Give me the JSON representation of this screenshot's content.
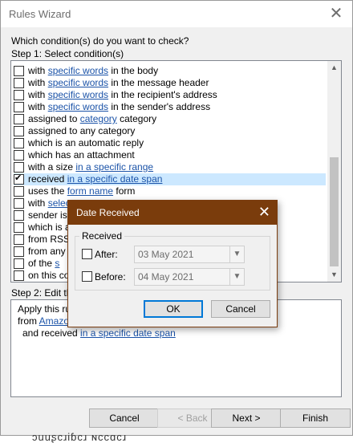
{
  "window": {
    "title": "Rules Wizard",
    "close_glyph": "✕"
  },
  "question": "Which condition(s) do you want to check?",
  "step1": "Step 1: Select condition(s)",
  "conditions": [
    {
      "pre": "with ",
      "link": "specific words",
      "post": " in the body",
      "checked": false
    },
    {
      "pre": "with ",
      "link": "specific words",
      "post": " in the message header",
      "checked": false
    },
    {
      "pre": "with ",
      "link": "specific words",
      "post": " in the recipient's address",
      "checked": false
    },
    {
      "pre": "with ",
      "link": "specific words",
      "post": " in the sender's address",
      "checked": false
    },
    {
      "pre": "assigned to ",
      "link": "category",
      "post": " category",
      "checked": false
    },
    {
      "pre": "assigned to any category",
      "link": "",
      "post": "",
      "checked": false
    },
    {
      "pre": "which is an automatic reply",
      "link": "",
      "post": "",
      "checked": false
    },
    {
      "pre": "which has an attachment",
      "link": "",
      "post": "",
      "checked": false
    },
    {
      "pre": "with a size ",
      "link": "in a specific range",
      "post": "",
      "checked": false
    },
    {
      "pre": "received ",
      "link": "in a specific date span",
      "post": "",
      "checked": true
    },
    {
      "pre": "uses the ",
      "link": "form name",
      "post": " form",
      "checked": false
    },
    {
      "pre": "with ",
      "link": "selec",
      "post": "",
      "checked": false
    },
    {
      "pre": "sender is i",
      "link": "",
      "post": "",
      "checked": false
    },
    {
      "pre": "which is a",
      "link": "",
      "post": "",
      "checked": false
    },
    {
      "pre": "from RSS F",
      "link": "",
      "post": "",
      "checked": false
    },
    {
      "pre": "from any R",
      "link": "",
      "post": "",
      "checked": false
    },
    {
      "pre": "of the ",
      "link": "s",
      "post": "",
      "checked": false
    },
    {
      "pre": "on this co",
      "link": "",
      "post": "",
      "checked": false
    }
  ],
  "step2": "Step 2: Edit th",
  "description": {
    "line1": "Apply this ru",
    "line2_pre": "from ",
    "line2_link": "Amazon",
    "line3_pre": "and received ",
    "line3_link": "in a specific date span"
  },
  "buttons": {
    "cancel": "Cancel",
    "back": "< Back",
    "next": "Next >",
    "finish": "Finish"
  },
  "bottom_text": "ɔuuʂcɹiɓcɹ ɴccɑcɹ",
  "dialog": {
    "title": "Date Received",
    "close_glyph": "✕",
    "group_label": "Received",
    "after_label": "After:",
    "after_value": "03 May 2021",
    "before_label": "Before:",
    "before_value": "04 May 2021",
    "ok": "OK",
    "cancel": "Cancel"
  }
}
